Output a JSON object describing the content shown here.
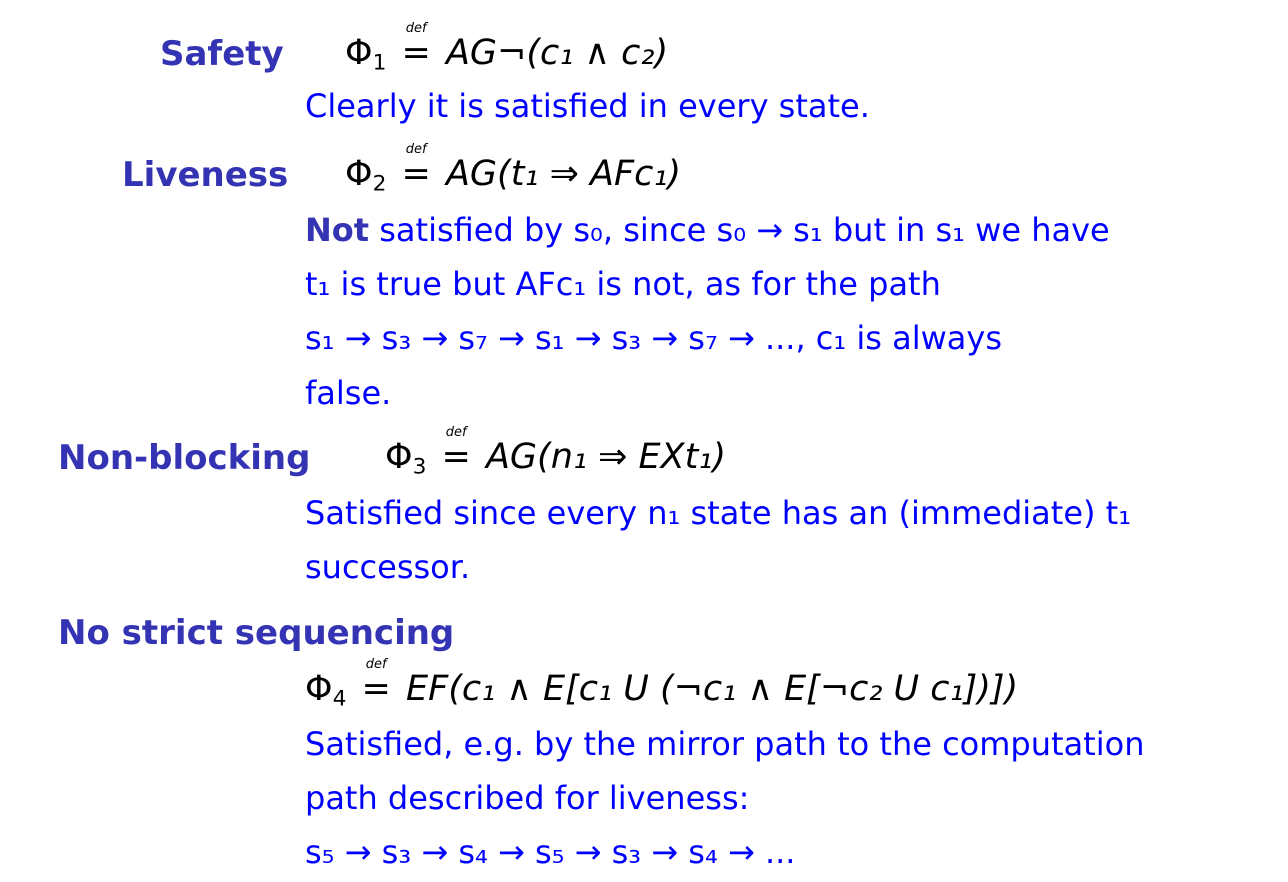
{
  "def_label": "def",
  "safety": {
    "term": "Safety",
    "phi": "Φ",
    "idx": "1",
    "formula_rhs": "AG¬(c₁ ∧ c₂)",
    "text": "Clearly it is satisfied in every state."
  },
  "liveness": {
    "term": "Liveness",
    "phi": "Φ",
    "idx": "2",
    "formula_rhs": "AG(t₁ ⇒ AFc₁)",
    "not_word": "Not",
    "line1": " satisfied by s₀, since s₀ → s₁ but in s₁ we have",
    "line2": "t₁ is true but AFc₁ is not, as for the path",
    "line3": "s₁ → s₃ → s₇ → s₁ → s₃ → s₇ → ..., c₁ is always",
    "line4": "false."
  },
  "nonblocking": {
    "term": "Non-blocking",
    "phi": "Φ",
    "idx": "3",
    "formula_rhs": "AG(n₁ ⇒ EXt₁)",
    "line1": "Satisfied since every n₁ state has an (immediate) t₁",
    "line2": "successor."
  },
  "nostrict": {
    "term": "No strict sequencing",
    "phi": "Φ",
    "idx": "4",
    "formula_rhs": "EF(c₁ ∧ E[c₁ U (¬c₁ ∧ E[¬c₂ U c₁])])",
    "line1": "Satisfied, e.g. by the mirror path to the computation",
    "line2": "path described for liveness:",
    "line3": "s₅ → s₃ → s₄ → s₅ → s₃ → s₄ → ..."
  }
}
